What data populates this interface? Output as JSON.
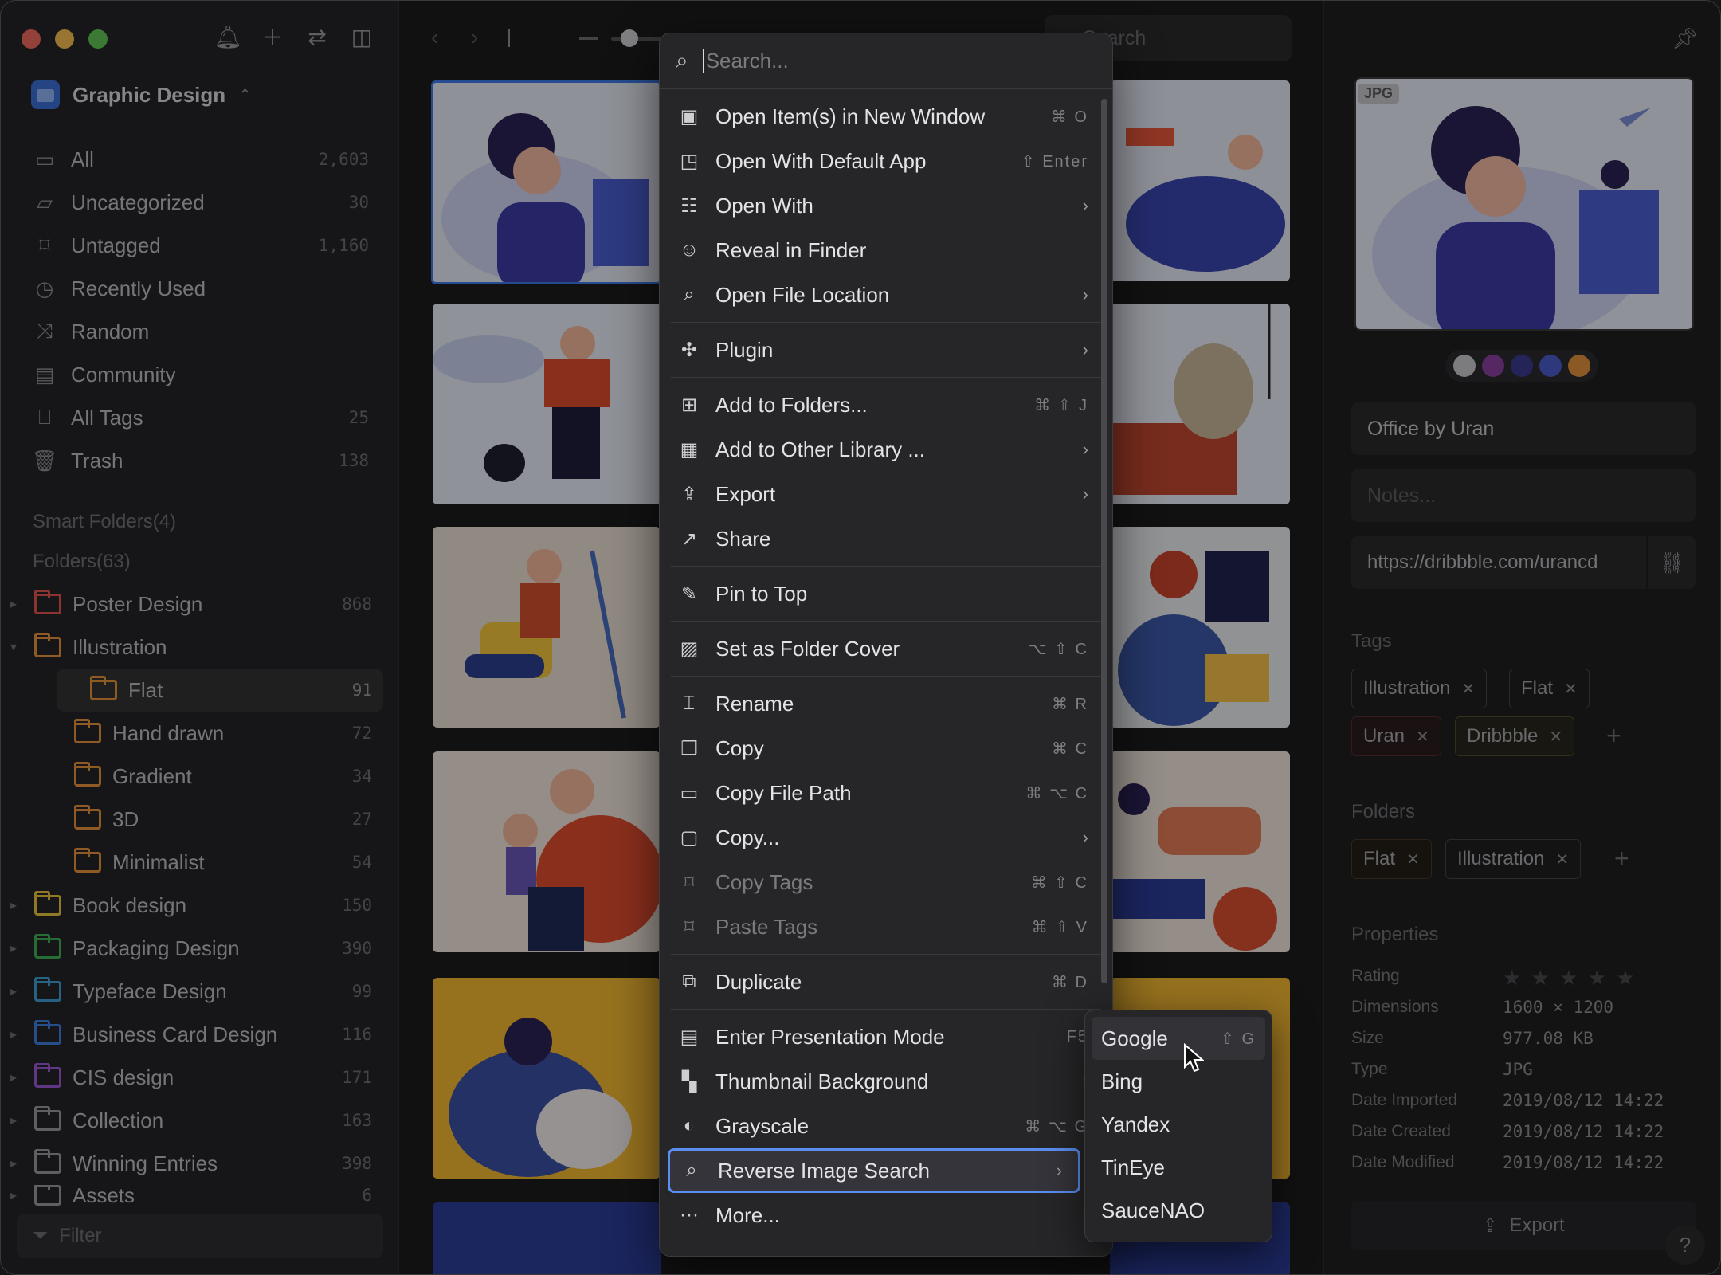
{
  "sidebar": {
    "library": "Graphic Design",
    "nav": [
      {
        "label": "All",
        "count": "2,603",
        "icon": "inbox-icon"
      },
      {
        "label": "Uncategorized",
        "count": "30",
        "icon": "folder-question-icon"
      },
      {
        "label": "Untagged",
        "count": "1,160",
        "icon": "tag-off-icon"
      },
      {
        "label": "Recently Used",
        "count": "",
        "icon": "clock-icon"
      },
      {
        "label": "Random",
        "count": "",
        "icon": "shuffle-icon"
      },
      {
        "label": "Community",
        "count": "",
        "icon": "community-icon"
      },
      {
        "label": "All Tags",
        "count": "25",
        "icon": "bookmark-icon"
      },
      {
        "label": "Trash",
        "count": "138",
        "icon": "trash-icon"
      }
    ],
    "smart_folders": "Smart Folders(4)",
    "folders_header": "Folders(63)",
    "folders": [
      {
        "label": "Poster Design",
        "count": "868",
        "color": "#e0544d",
        "indent": 0,
        "arrow": "▸"
      },
      {
        "label": "Illustration",
        "count": "",
        "color": "#e8923c",
        "indent": 0,
        "arrow": "▾"
      },
      {
        "label": "Flat",
        "count": "91",
        "color": "#e8923c",
        "indent": 1,
        "arrow": ""
      },
      {
        "label": "Hand drawn",
        "count": "72",
        "color": "#e8923c",
        "indent": 1,
        "arrow": ""
      },
      {
        "label": "Gradient",
        "count": "34",
        "color": "#e8923c",
        "indent": 1,
        "arrow": ""
      },
      {
        "label": "3D",
        "count": "27",
        "color": "#e8923c",
        "indent": 1,
        "arrow": ""
      },
      {
        "label": "Minimalist",
        "count": "54",
        "color": "#e8923c",
        "indent": 1,
        "arrow": ""
      },
      {
        "label": "Book design",
        "count": "150",
        "color": "#e8c23c",
        "indent": 0,
        "arrow": "▸"
      },
      {
        "label": "Packaging Design",
        "count": "390",
        "color": "#3fae55",
        "indent": 0,
        "arrow": "▸"
      },
      {
        "label": "Typeface Design",
        "count": "99",
        "color": "#3e9fd6",
        "indent": 0,
        "arrow": "▸"
      },
      {
        "label": "Business Card Design",
        "count": "116",
        "color": "#3e7fe0",
        "indent": 0,
        "arrow": "▸"
      },
      {
        "label": "CIS design",
        "count": "171",
        "color": "#9b59d6",
        "indent": 0,
        "arrow": "▸"
      },
      {
        "label": "Collection",
        "count": "163",
        "color": "#9a9a9e",
        "indent": 0,
        "arrow": "▸"
      },
      {
        "label": "Winning Entries",
        "count": "398",
        "color": "#9a9a9e",
        "indent": 0,
        "arrow": "▸"
      },
      {
        "label": "Assets",
        "count": "6",
        "color": "#9a9a9e",
        "indent": 0,
        "arrow": "▸"
      }
    ],
    "filter_placeholder": "Filter"
  },
  "toolbar": {
    "search_placeholder": "Search"
  },
  "menu": {
    "search_placeholder": "Search...",
    "items": [
      {
        "label": "Open Item(s) in New Window",
        "shortcut": "⌘ O",
        "icon": "window-icon"
      },
      {
        "label": "Open With Default App",
        "shortcut": "⇧ Enter",
        "icon": "app-icon"
      },
      {
        "label": "Open With",
        "sub": true,
        "icon": "open-with-icon"
      },
      {
        "label": "Reveal in Finder",
        "icon": "finder-icon"
      },
      {
        "label": "Open File Location",
        "sub": true,
        "icon": "file-search-icon"
      },
      {
        "sep": true
      },
      {
        "label": "Plugin",
        "sub": true,
        "icon": "puzzle-icon"
      },
      {
        "sep": true
      },
      {
        "label": "Add to Folders...",
        "shortcut": "⌘ ⇧ J",
        "icon": "folder-add-icon"
      },
      {
        "label": "Add to Other Library ...",
        "sub": true,
        "icon": "library-icon"
      },
      {
        "label": "Export",
        "sub": true,
        "icon": "export-icon"
      },
      {
        "label": "Share",
        "icon": "share-icon"
      },
      {
        "sep": true
      },
      {
        "label": "Pin to Top",
        "icon": "pin-icon"
      },
      {
        "sep": true
      },
      {
        "label": "Set as Folder Cover",
        "shortcut": "⌥ ⇧ C",
        "icon": "image-icon"
      },
      {
        "sep": true
      },
      {
        "label": "Rename",
        "shortcut": "⌘ R",
        "icon": "rename-icon"
      },
      {
        "label": "Copy",
        "shortcut": "⌘ C",
        "icon": "copy-icon"
      },
      {
        "label": "Copy File Path",
        "shortcut": "⌘ ⌥ C",
        "icon": "terminal-icon"
      },
      {
        "label": "Copy...",
        "sub": true,
        "icon": "copy-more-icon"
      },
      {
        "label": "Copy Tags",
        "shortcut": "⌘ ⇧ C",
        "icon": "tag-copy-icon",
        "disabled": true
      },
      {
        "label": "Paste Tags",
        "shortcut": "⌘ ⇧ V",
        "icon": "tag-paste-icon",
        "disabled": true
      },
      {
        "sep": true
      },
      {
        "label": "Duplicate",
        "shortcut": "⌘ D",
        "icon": "duplicate-icon"
      },
      {
        "sep": true
      },
      {
        "label": "Enter Presentation Mode",
        "shortcut": "F5",
        "icon": "presentation-icon"
      },
      {
        "label": "Thumbnail Background",
        "sub": true,
        "icon": "checker-icon"
      },
      {
        "label": "Grayscale",
        "shortcut": "⌘ ⌥ G",
        "icon": "contrast-icon"
      },
      {
        "label": "Reverse Image Search",
        "sub": true,
        "icon": "image-search-icon",
        "highlight": true
      },
      {
        "label": "More...",
        "sub": true,
        "icon": "more-icon"
      }
    ]
  },
  "submenu": [
    {
      "label": "Google",
      "shortcut": "⇧ G"
    },
    {
      "label": "Bing",
      "shortcut": ""
    },
    {
      "label": "Yandex",
      "shortcut": ""
    },
    {
      "label": "TinEye",
      "shortcut": ""
    },
    {
      "label": "SauceNAO",
      "shortcut": ""
    }
  ],
  "inspector": {
    "badge": "JPG",
    "swatches": [
      "#c8c8cc",
      "#8a3fa0",
      "#3b3a8f",
      "#4a5cc8",
      "#e0913a"
    ],
    "title": "Office by Uran",
    "notes_placeholder": "Notes...",
    "url": "https://dribbble.com/urancd",
    "tags_header": "Tags",
    "tags": [
      "Illustration",
      "Flat",
      "Uran",
      "Dribbble"
    ],
    "folders_header": "Folders",
    "folders": [
      "Flat",
      "Illustration"
    ],
    "properties_header": "Properties",
    "properties": [
      {
        "k": "Rating",
        "v": "★ ★ ★ ★ ★"
      },
      {
        "k": "Dimensions",
        "v": "1600 × 1200"
      },
      {
        "k": "Size",
        "v": "977.08 KB"
      },
      {
        "k": "Type",
        "v": "JPG"
      },
      {
        "k": "Date Imported",
        "v": "2019/08/12 14:22"
      },
      {
        "k": "Date Created",
        "v": "2019/08/12 14:22"
      },
      {
        "k": "Date Modified",
        "v": "2019/08/12 14:22"
      }
    ],
    "export_label": "Export",
    "help": "?"
  }
}
